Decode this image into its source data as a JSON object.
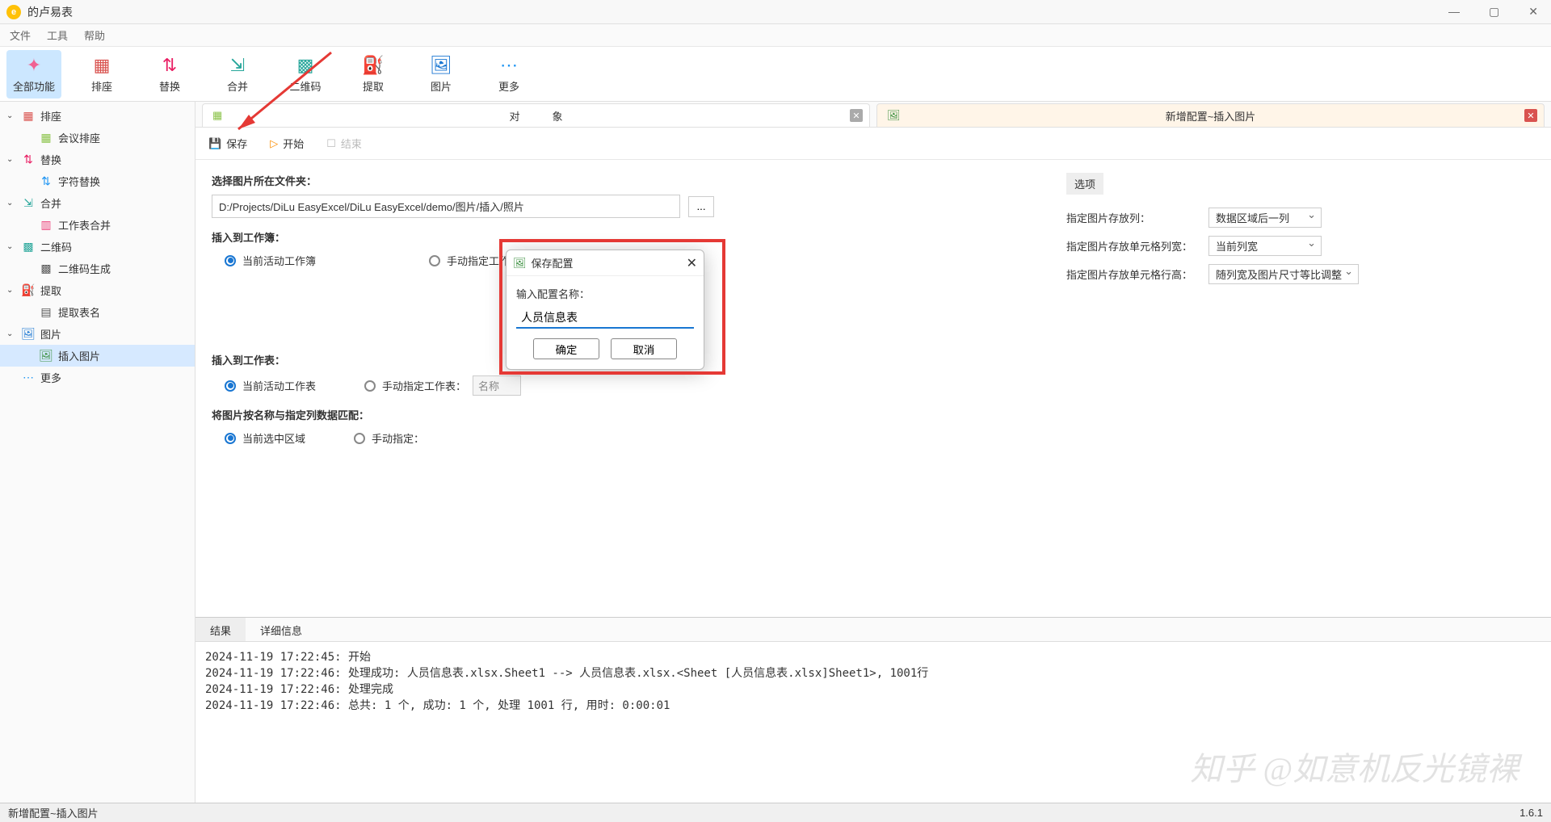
{
  "window": {
    "title": "的卢易表"
  },
  "menu": {
    "file": "文件",
    "tool": "工具",
    "help": "帮助"
  },
  "toolbar": [
    {
      "label": "全部功能",
      "icon": "✦",
      "color": "#f06292",
      "active": true
    },
    {
      "label": "排座",
      "icon": "▦",
      "color": "#d9534f",
      "active": false
    },
    {
      "label": "替换",
      "icon": "⇅",
      "color": "#e91e63",
      "active": false
    },
    {
      "label": "合并",
      "icon": "⇲",
      "color": "#26a69a",
      "active": false
    },
    {
      "label": "二维码",
      "icon": "▩",
      "color": "#26a69a",
      "active": false
    },
    {
      "label": "提取",
      "icon": "⛽",
      "color": "#455a64",
      "active": false
    },
    {
      "label": "图片",
      "icon": "🖼",
      "color": "#1976d2",
      "active": false
    },
    {
      "label": "更多",
      "icon": "⋯",
      "color": "#2196f3",
      "active": false
    }
  ],
  "tree": {
    "seat": {
      "label": "排座",
      "child": "会议排座"
    },
    "replace": {
      "label": "替换",
      "child": "字符替换"
    },
    "merge": {
      "label": "合并",
      "child": "工作表合并"
    },
    "qrcode": {
      "label": "二维码",
      "child": "二维码生成"
    },
    "extract": {
      "label": "提取",
      "child": "提取表名"
    },
    "image": {
      "label": "图片",
      "child": "插入图片"
    },
    "more": {
      "label": "更多"
    }
  },
  "tabs": {
    "left_parts": [
      "对",
      "象"
    ],
    "right": "新增配置~插入图片"
  },
  "actions": {
    "save": "保存",
    "start": "开始",
    "end": "结束"
  },
  "form": {
    "folder_label": "选择图片所在文件夹：",
    "folder_path": "D:/Projects/DiLu EasyExcel/DiLu EasyExcel/demo/图片/插入/照片",
    "workbook_label": "插入到工作簿：",
    "workbook_opt1": "当前活动工作簿",
    "workbook_opt2": "手动指定工作簿：",
    "worksheet_label": "插入到工作表：",
    "worksheet_opt1": "当前活动工作表",
    "worksheet_opt2": "手动指定工作表：",
    "worksheet_name": "名称",
    "match_label": "将图片按名称与指定列数据匹配：",
    "match_opt1": "当前选中区域",
    "match_opt2": "手动指定："
  },
  "options": {
    "header": "选项",
    "col_label": "指定图片存放列：",
    "col_value": "数据区域后一列",
    "width_label": "指定图片存放单元格列宽：",
    "width_value": "当前列宽",
    "height_label": "指定图片存放单元格行高：",
    "height_value": "随列宽及图片尺寸等比调整"
  },
  "log": {
    "tab_result": "结果",
    "tab_detail": "详细信息",
    "lines": [
      "2024-11-19 17:22:45: 开始",
      "2024-11-19 17:22:46: 处理成功: 人员信息表.xlsx.Sheet1 --> 人员信息表.xlsx.<Sheet [人员信息表.xlsx]Sheet1>, 1001行",
      "2024-11-19 17:22:46: 处理完成",
      "2024-11-19 17:22:46: 总共: 1 个, 成功: 1 个, 处理 1001 行, 用时: 0:00:01"
    ]
  },
  "dialog": {
    "title": "保存配置",
    "label": "输入配置名称：",
    "value": "人员信息表",
    "ok": "确定",
    "cancel": "取消"
  },
  "status": {
    "left": "新增配置~插入图片",
    "right": "1.6.1"
  },
  "watermark": "知乎 @如意机反光镜裸"
}
